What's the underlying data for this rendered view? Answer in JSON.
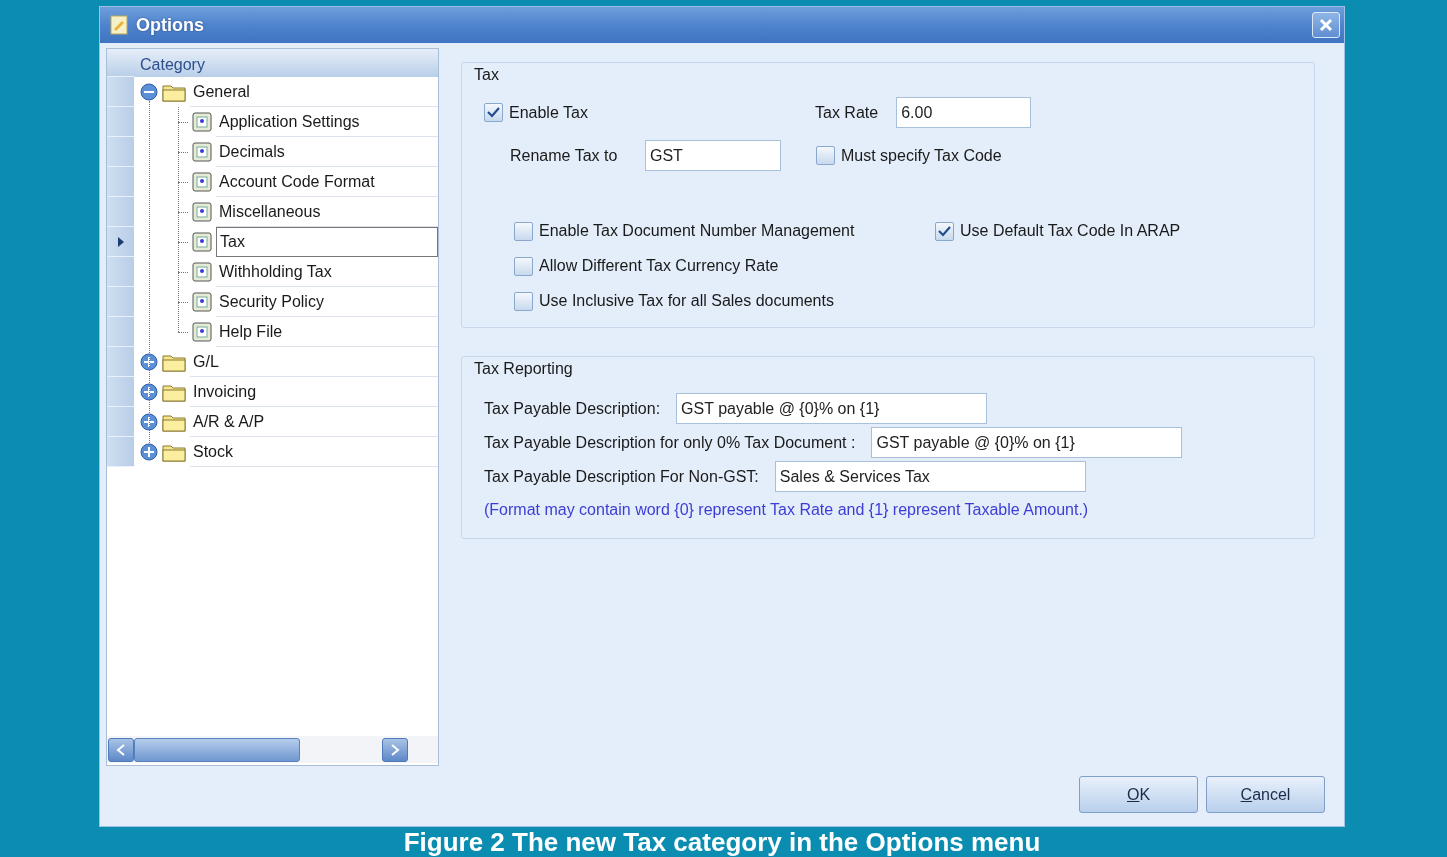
{
  "window": {
    "title": "Options"
  },
  "tree": {
    "header": "Category",
    "items": [
      {
        "label": "General",
        "kind": "folder",
        "expanded": true,
        "selected": false,
        "children": [
          {
            "label": "Application Settings",
            "kind": "page",
            "selected": false
          },
          {
            "label": "Decimals",
            "kind": "page",
            "selected": false
          },
          {
            "label": "Account Code Format",
            "kind": "page",
            "selected": false
          },
          {
            "label": "Miscellaneous",
            "kind": "page",
            "selected": false
          },
          {
            "label": "Tax",
            "kind": "page",
            "selected": true
          },
          {
            "label": "Withholding Tax",
            "kind": "page",
            "selected": false
          },
          {
            "label": "Security Policy",
            "kind": "page",
            "selected": false
          },
          {
            "label": "Help File",
            "kind": "page",
            "selected": false
          }
        ]
      },
      {
        "label": "G/L",
        "kind": "folder",
        "expanded": false,
        "selected": false
      },
      {
        "label": "Invoicing",
        "kind": "folder",
        "expanded": false,
        "selected": false
      },
      {
        "label": "A/R & A/P",
        "kind": "folder",
        "expanded": false,
        "selected": false
      },
      {
        "label": "Stock",
        "kind": "folder",
        "expanded": false,
        "selected": false
      }
    ]
  },
  "tax_group": {
    "title": "Tax",
    "enable_tax": {
      "label": "Enable Tax",
      "checked": true
    },
    "tax_rate": {
      "label": "Tax Rate",
      "value": "6.00"
    },
    "rename_tax": {
      "label": "Rename Tax to",
      "value": "GST"
    },
    "must_specify": {
      "label": "Must specify Tax Code",
      "checked": false
    },
    "option_rows": [
      [
        {
          "label": "Enable Tax Document Number Management",
          "checked": false
        },
        {
          "label": "Use Default Tax Code In ARAP",
          "checked": true
        }
      ],
      [
        {
          "label": "Allow Different Tax Currency Rate",
          "checked": false
        }
      ],
      [
        {
          "label": "Use Inclusive Tax for all Sales documents",
          "checked": false
        }
      ]
    ]
  },
  "reporting_group": {
    "title": "Tax Reporting",
    "fields": [
      {
        "label": "Tax Payable Description:",
        "value": "GST payable @ {0}% on {1}"
      },
      {
        "label": "Tax Payable Description for only 0% Tax Document :",
        "value": "GST payable @ {0}% on {1}"
      },
      {
        "label": "Tax Payable Description For Non-GST:",
        "value": "Sales & Services Tax"
      }
    ],
    "note": "(Format may contain word {0} represent Tax Rate and {1} represent Taxable Amount.)"
  },
  "buttons": [
    {
      "mnemonic": "O",
      "rest": "K"
    },
    {
      "mnemonic": "C",
      "rest": "ancel"
    }
  ],
  "caption": "Figure 2 The new Tax category in the Options menu"
}
